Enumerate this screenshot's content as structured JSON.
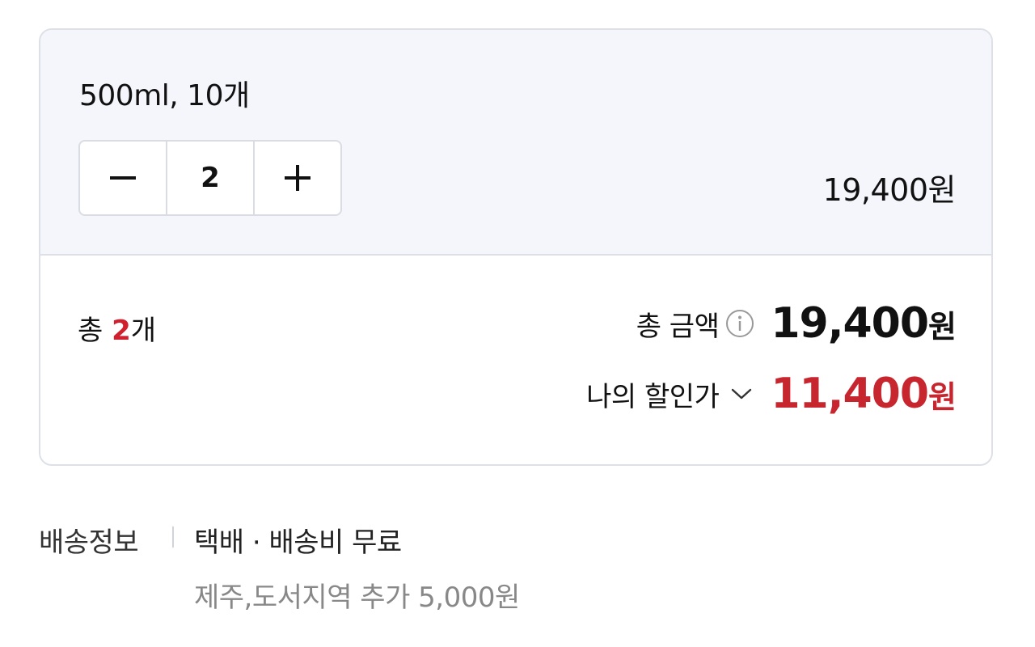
{
  "option": {
    "name": "500ml, 10개",
    "quantity": "2",
    "price": "19,400원"
  },
  "summary": {
    "count_prefix": "총 ",
    "count_value": "2",
    "count_suffix": "개",
    "total_label": "총 금액",
    "total_amount": "19,400",
    "total_unit": "원",
    "discount_label": "나의 할인가",
    "discount_amount": "11,400",
    "discount_unit": "원"
  },
  "shipping": {
    "title": "배송정보",
    "method": "택배 · 배송비 무료",
    "extra": "제주,도서지역 추가 5,000원"
  },
  "icons": {
    "minus": "minus-icon",
    "plus": "plus-icon",
    "info": "info-icon",
    "chevron": "chevron-down-icon"
  },
  "colors": {
    "accent_red": "#c8262f",
    "option_bg": "#f4f6fb",
    "border": "#dde1e7"
  }
}
